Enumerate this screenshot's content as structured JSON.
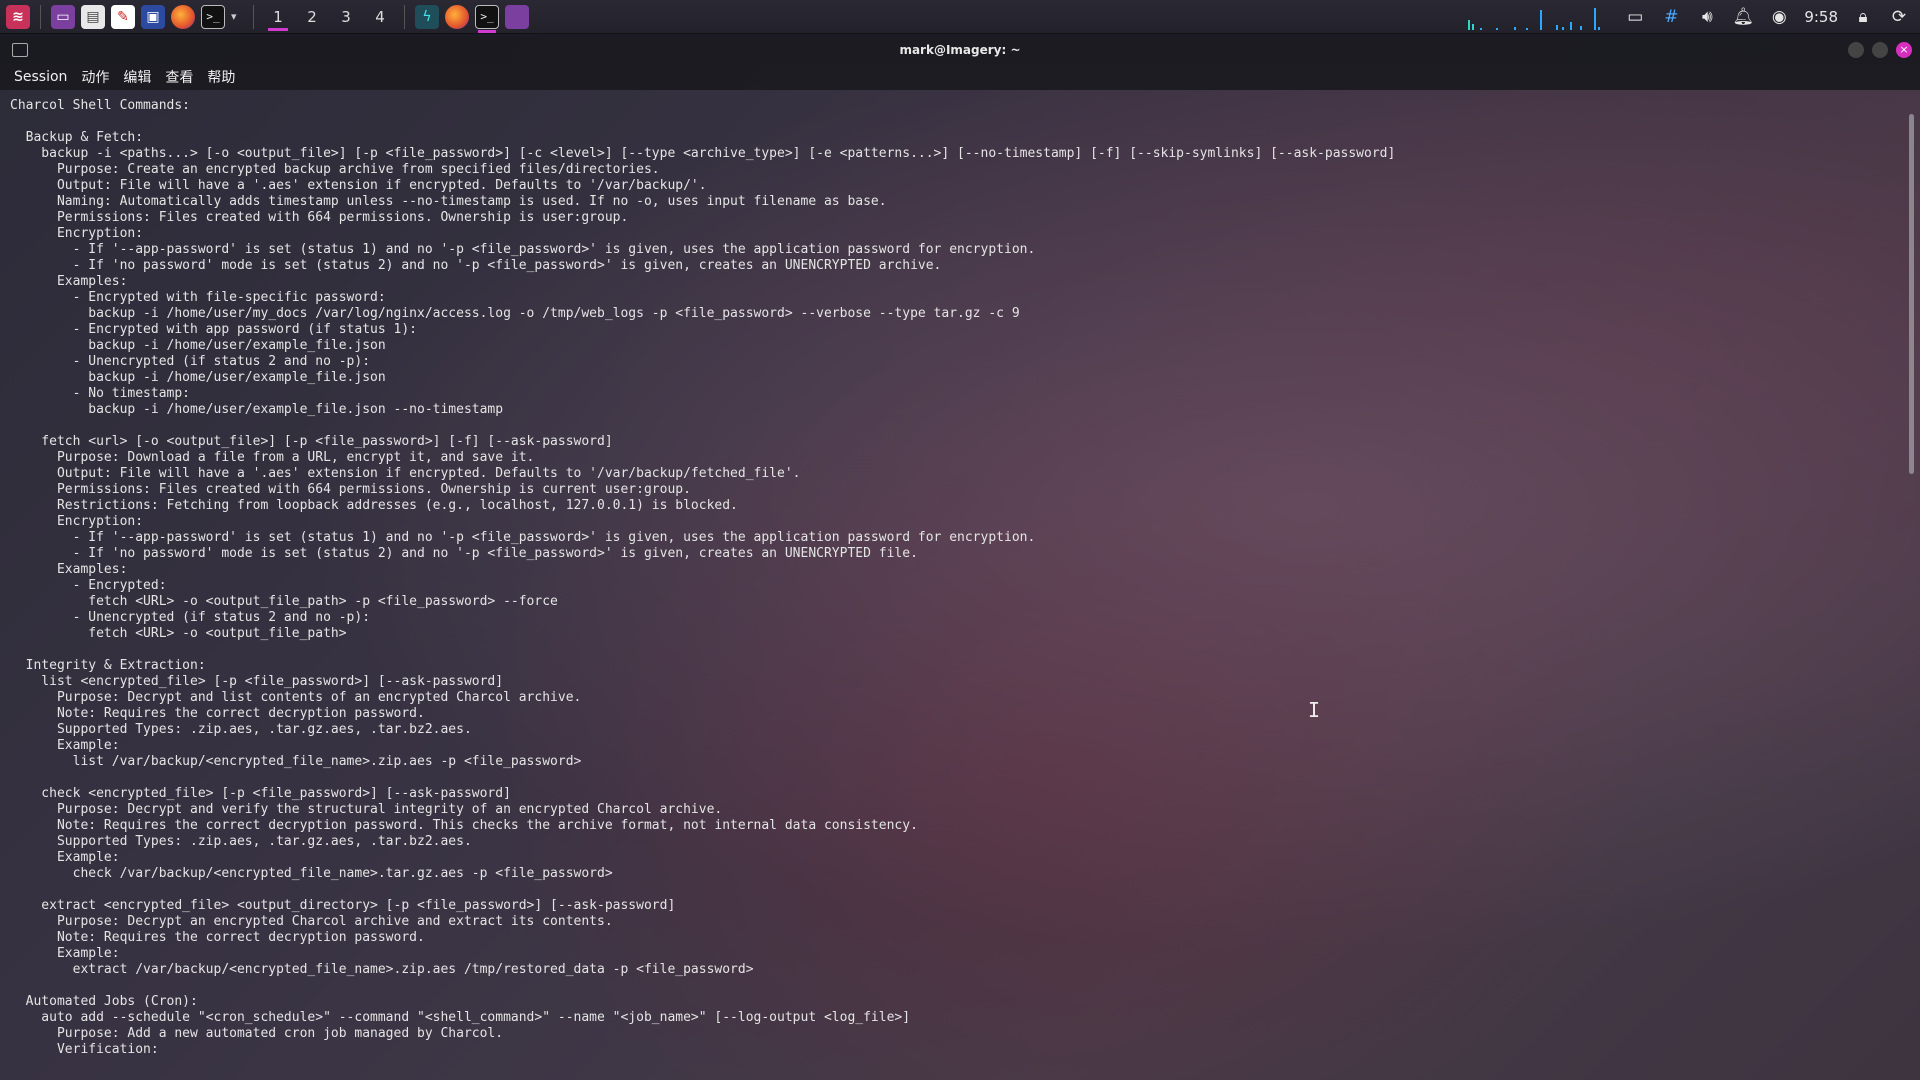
{
  "panel": {
    "workspaces": [
      "1",
      "2",
      "3",
      "4"
    ],
    "clock": "9:58"
  },
  "window": {
    "title": "mark@Imagery: ~"
  },
  "menu": [
    "Session",
    "动作",
    "编辑",
    "查看",
    "帮助"
  ],
  "terminal_lines": [
    "Charcol Shell Commands:",
    "",
    "  Backup & Fetch:",
    "    backup -i <paths...> [-o <output_file>] [-p <file_password>] [-c <level>] [--type <archive_type>] [-e <patterns...>] [--no-timestamp] [-f] [--skip-symlinks] [--ask-password]",
    "      Purpose: Create an encrypted backup archive from specified files/directories.",
    "      Output: File will have a '.aes' extension if encrypted. Defaults to '/var/backup/'.",
    "      Naming: Automatically adds timestamp unless --no-timestamp is used. If no -o, uses input filename as base.",
    "      Permissions: Files created with 664 permissions. Ownership is user:group.",
    "      Encryption:",
    "        - If '--app-password' is set (status 1) and no '-p <file_password>' is given, uses the application password for encryption.",
    "        - If 'no password' mode is set (status 2) and no '-p <file_password>' is given, creates an UNENCRYPTED archive.",
    "      Examples:",
    "        - Encrypted with file-specific password:",
    "          backup -i /home/user/my_docs /var/log/nginx/access.log -o /tmp/web_logs -p <file_password> --verbose --type tar.gz -c 9",
    "        - Encrypted with app password (if status 1):",
    "          backup -i /home/user/example_file.json",
    "        - Unencrypted (if status 2 and no -p):",
    "          backup -i /home/user/example_file.json",
    "        - No timestamp:",
    "          backup -i /home/user/example_file.json --no-timestamp",
    "",
    "    fetch <url> [-o <output_file>] [-p <file_password>] [-f] [--ask-password]",
    "      Purpose: Download a file from a URL, encrypt it, and save it.",
    "      Output: File will have a '.aes' extension if encrypted. Defaults to '/var/backup/fetched_file'.",
    "      Permissions: Files created with 664 permissions. Ownership is current user:group.",
    "      Restrictions: Fetching from loopback addresses (e.g., localhost, 127.0.0.1) is blocked.",
    "      Encryption:",
    "        - If '--app-password' is set (status 1) and no '-p <file_password>' is given, uses the application password for encryption.",
    "        - If 'no password' mode is set (status 2) and no '-p <file_password>' is given, creates an UNENCRYPTED file.",
    "      Examples:",
    "        - Encrypted:",
    "          fetch <URL> -o <output_file_path> -p <file_password> --force",
    "        - Unencrypted (if status 2 and no -p):",
    "          fetch <URL> -o <output_file_path>",
    "",
    "  Integrity & Extraction:",
    "    list <encrypted_file> [-p <file_password>] [--ask-password]",
    "      Purpose: Decrypt and list contents of an encrypted Charcol archive.",
    "      Note: Requires the correct decryption password.",
    "      Supported Types: .zip.aes, .tar.gz.aes, .tar.bz2.aes.",
    "      Example:",
    "        list /var/backup/<encrypted_file_name>.zip.aes -p <file_password>",
    "",
    "    check <encrypted_file> [-p <file_password>] [--ask-password]",
    "      Purpose: Decrypt and verify the structural integrity of an encrypted Charcol archive.",
    "      Note: Requires the correct decryption password. This checks the archive format, not internal data consistency.",
    "      Supported Types: .zip.aes, .tar.gz.aes, .tar.bz2.aes.",
    "      Example:",
    "        check /var/backup/<encrypted_file_name>.tar.gz.aes -p <file_password>",
    "",
    "    extract <encrypted_file> <output_directory> [-p <file_password>] [--ask-password]",
    "      Purpose: Decrypt an encrypted Charcol archive and extract its contents.",
    "      Note: Requires the correct decryption password.",
    "      Example:",
    "        extract /var/backup/<encrypted_file_name>.zip.aes /tmp/restored_data -p <file_password>",
    "",
    "  Automated Jobs (Cron):",
    "    auto add --schedule \"<cron_schedule>\" --command \"<shell_command>\" --name \"<job_name>\" [--log-output <log_file>]",
    "      Purpose: Add a new automated cron job managed by Charcol.",
    "      Verification:"
  ]
}
